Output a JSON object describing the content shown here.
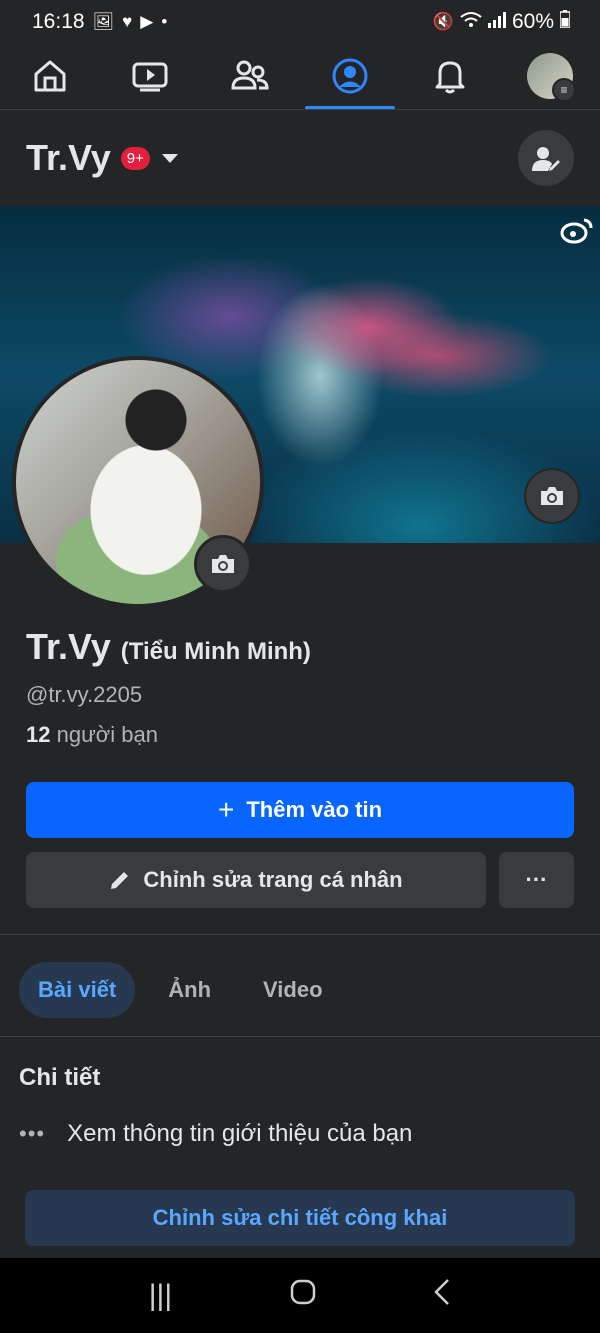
{
  "status_bar": {
    "time": "16:18",
    "left_icons": [
      "image-icon",
      "heart-icon",
      "youtube-icon",
      "dot-icon"
    ],
    "battery": "60%",
    "right_icons": [
      "mute-icon",
      "wifi-icon",
      "signal-icon",
      "battery-icon"
    ]
  },
  "nav": {
    "items": [
      {
        "name": "home",
        "icon": "home-icon",
        "active": false
      },
      {
        "name": "video",
        "icon": "video-icon",
        "active": false
      },
      {
        "name": "friends",
        "icon": "friends-icon",
        "active": false
      },
      {
        "name": "profile",
        "icon": "profile-icon",
        "active": true
      },
      {
        "name": "notifications",
        "icon": "bell-icon",
        "active": false
      },
      {
        "name": "menu",
        "icon": "avatar-menu-icon",
        "active": false
      }
    ]
  },
  "header": {
    "name": "Tr.Vy",
    "badge": "9+"
  },
  "profile": {
    "name": "Tr.Vy",
    "alt_name": "(Tiểu Minh Minh)",
    "username": "@tr.vy.2205",
    "friends_count": "12",
    "friends_label": "người bạn"
  },
  "buttons": {
    "add_story": "Thêm vào tin",
    "edit_profile": "Chỉnh sửa trang cá nhân",
    "more": "···"
  },
  "tabs": [
    {
      "label": "Bài viết",
      "active": true
    },
    {
      "label": "Ảnh",
      "active": false
    },
    {
      "label": "Video",
      "active": false
    }
  ],
  "details": {
    "title": "Chi tiết",
    "intro_text": "Xem thông tin giới thiệu của bạn",
    "edit_public_label": "Chỉnh sửa chi tiết công khai"
  },
  "colors": {
    "accent": "#0866ff",
    "background": "#242526",
    "tab_active_bg": "#263951",
    "badge": "#e41e3f"
  }
}
